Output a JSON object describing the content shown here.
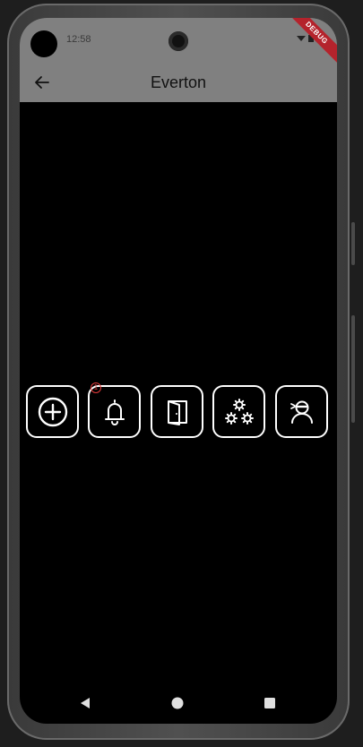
{
  "status_bar": {
    "time": "12:58",
    "debug_banner": "DEBUG"
  },
  "app_bar": {
    "title": "Everton",
    "back_icon": "arrow-left-icon"
  },
  "actions": [
    {
      "name": "add-button",
      "icon": "plus-circle-icon"
    },
    {
      "name": "notifications-button",
      "icon": "bell-icon",
      "badge": "1"
    },
    {
      "name": "door-button",
      "icon": "door-icon"
    },
    {
      "name": "cogs-button",
      "icon": "cogs-icon"
    },
    {
      "name": "profile-button",
      "icon": "user-icon"
    }
  ],
  "colors": {
    "app_bar": "#808080",
    "background": "#000000",
    "icon_stroke": "#ffffff",
    "badge": "#e23a3a",
    "debug_banner": "#b4232c"
  },
  "nav": {
    "back_icon": "triangle-back-icon",
    "home_icon": "circle-home-icon",
    "recents_icon": "square-recents-icon"
  }
}
